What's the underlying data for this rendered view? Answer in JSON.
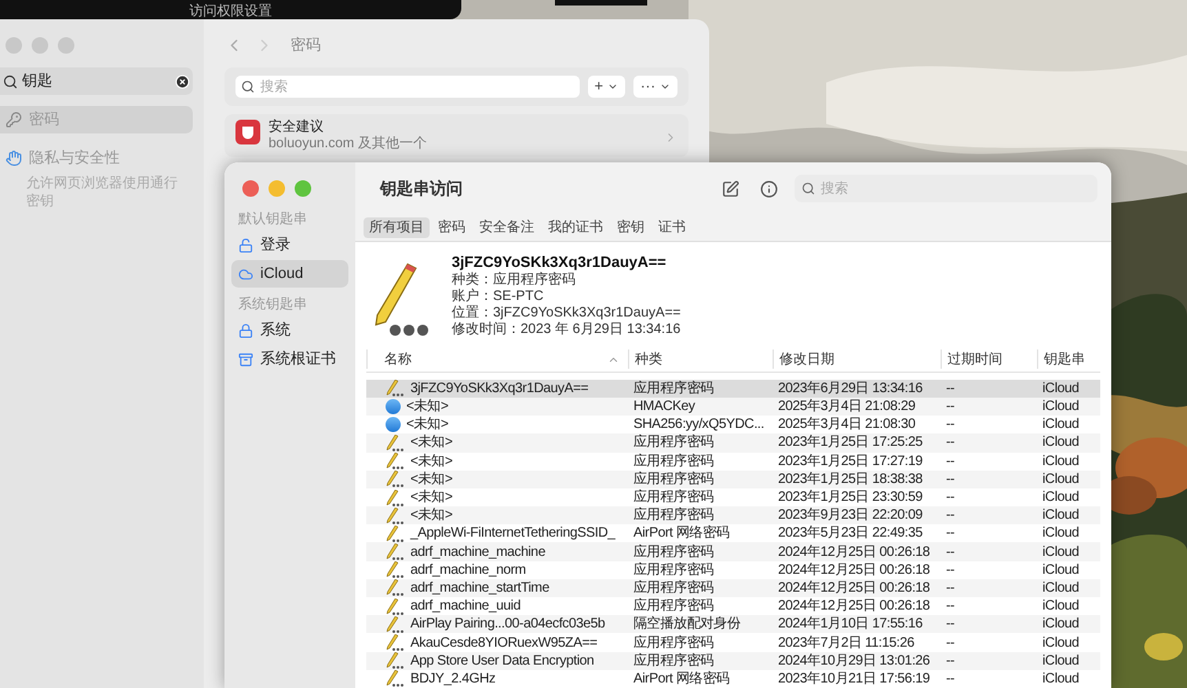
{
  "top_bar": {
    "title": "访问权限设置"
  },
  "settings_window": {
    "sidebar": {
      "search": {
        "value": "钥匙"
      },
      "items": [
        {
          "label": "密码",
          "selected": true
        },
        {
          "label": "隐私与安全性",
          "selected": false,
          "subtitle": "允许网页浏览器使用通行密钥"
        }
      ]
    },
    "header": {
      "title": "密码"
    },
    "search": {
      "placeholder": "搜索"
    },
    "buttons": [
      "+",
      "···"
    ],
    "card": {
      "title": "安全建议",
      "subtitle": "boluoyun.com 及其他一个"
    }
  },
  "keychain_window": {
    "title": "钥匙串访问",
    "search": {
      "placeholder": "搜索"
    },
    "sidebar": {
      "sections": [
        {
          "heading": "默认钥匙串",
          "items": [
            {
              "label": "登录",
              "selected": false
            },
            {
              "label": "iCloud",
              "selected": true
            }
          ]
        },
        {
          "heading": "系统钥匙串",
          "items": [
            {
              "label": "系统",
              "selected": false
            },
            {
              "label": "系统根证书",
              "selected": false
            }
          ]
        }
      ]
    },
    "tabs": [
      {
        "label": "所有项目",
        "selected": true
      },
      {
        "label": "密码",
        "selected": false
      },
      {
        "label": "安全备注",
        "selected": false
      },
      {
        "label": "我的证书",
        "selected": false
      },
      {
        "label": "密钥",
        "selected": false
      },
      {
        "label": "证书",
        "selected": false
      }
    ],
    "detail": {
      "name": "3jFZC9YoSKk3Xq3r1DauyA==",
      "lines": [
        "种类：应用程序密码",
        "账户：SE-PTC",
        "位置：3jFZC9YoSKk3Xq3r1DauyA==",
        "修改时间：2023 年 6月29日 13:34:16"
      ]
    },
    "table": {
      "columns": [
        "名称",
        "种类",
        "修改日期",
        "过期时间",
        "钥匙串"
      ],
      "rows": [
        {
          "kind": "password",
          "selected": true,
          "cells": [
            "3jFZC9YoSKk3Xq3r1DauyA==",
            "应用程序密码",
            "2023年6月29日 13:34:16",
            "--",
            "iCloud"
          ]
        },
        {
          "kind": "key",
          "selected": false,
          "cells": [
            "<未知>",
            "HMACKey",
            "2025年3月4日 21:08:29",
            "--",
            "iCloud"
          ]
        },
        {
          "kind": "key",
          "selected": false,
          "cells": [
            "<未知>",
            "SHA256:yy/xQ5YDC...",
            "2025年3月4日 21:08:30",
            "--",
            "iCloud"
          ]
        },
        {
          "kind": "password",
          "selected": false,
          "cells": [
            "<未知>",
            "应用程序密码",
            "2023年1月25日 17:25:25",
            "--",
            "iCloud"
          ]
        },
        {
          "kind": "password",
          "selected": false,
          "cells": [
            "<未知>",
            "应用程序密码",
            "2023年1月25日 17:27:19",
            "--",
            "iCloud"
          ]
        },
        {
          "kind": "password",
          "selected": false,
          "cells": [
            "<未知>",
            "应用程序密码",
            "2023年1月25日 18:38:38",
            "--",
            "iCloud"
          ]
        },
        {
          "kind": "password",
          "selected": false,
          "cells": [
            "<未知>",
            "应用程序密码",
            "2023年1月25日 23:30:59",
            "--",
            "iCloud"
          ]
        },
        {
          "kind": "password",
          "selected": false,
          "cells": [
            "<未知>",
            "应用程序密码",
            "2023年9月23日 22:20:09",
            "--",
            "iCloud"
          ]
        },
        {
          "kind": "password",
          "selected": false,
          "cells": [
            "_AppleWi-FiInternetTetheringSSID_",
            "AirPort 网络密码",
            "2023年5月23日 22:49:35",
            "--",
            "iCloud"
          ]
        },
        {
          "kind": "password",
          "selected": false,
          "cells": [
            "adrf_machine_machine",
            "应用程序密码",
            "2024年12月25日 00:26:18",
            "--",
            "iCloud"
          ]
        },
        {
          "kind": "password",
          "selected": false,
          "cells": [
            "adrf_machine_norm",
            "应用程序密码",
            "2024年12月25日 00:26:18",
            "--",
            "iCloud"
          ]
        },
        {
          "kind": "password",
          "selected": false,
          "cells": [
            "adrf_machine_startTime",
            "应用程序密码",
            "2024年12月25日 00:26:18",
            "--",
            "iCloud"
          ]
        },
        {
          "kind": "password",
          "selected": false,
          "cells": [
            "adrf_machine_uuid",
            "应用程序密码",
            "2024年12月25日 00:26:18",
            "--",
            "iCloud"
          ]
        },
        {
          "kind": "password",
          "selected": false,
          "cells": [
            "AirPlay Pairing...00-a04ecfc03e5b",
            "隔空播放配对身份",
            "2024年1月10日 17:55:16",
            "--",
            "iCloud"
          ]
        },
        {
          "kind": "password",
          "selected": false,
          "cells": [
            "AkauCesde8YIORuexW95ZA==",
            "应用程序密码",
            "2023年7月2日 11:15:26",
            "--",
            "iCloud"
          ]
        },
        {
          "kind": "password",
          "selected": false,
          "cells": [
            "App Store User Data Encryption",
            "应用程序密码",
            "2024年10月29日 13:01:26",
            "--",
            "iCloud"
          ]
        },
        {
          "kind": "password",
          "selected": false,
          "cells": [
            "BDJY_2.4GHz",
            "AirPort 网络密码",
            "2023年10月21日 17:56:19",
            "--",
            "iCloud"
          ]
        }
      ]
    }
  }
}
